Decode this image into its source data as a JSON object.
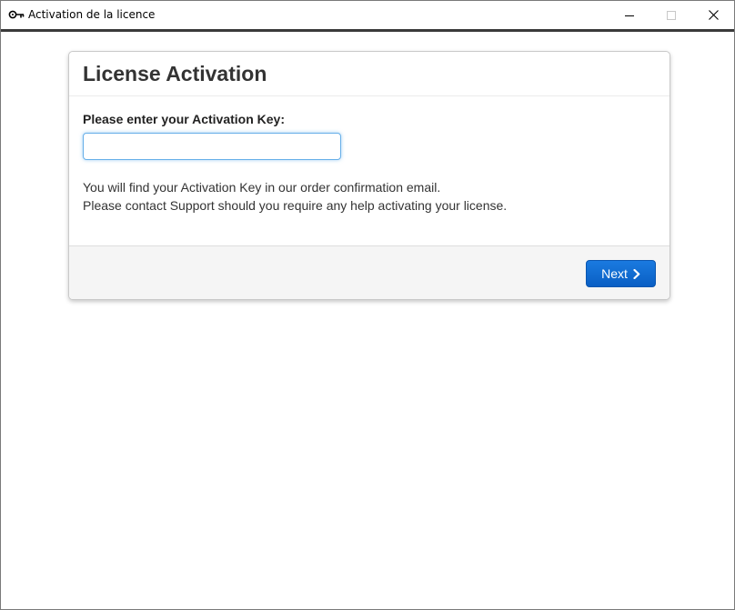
{
  "window": {
    "title": "Activation de la licence",
    "icon": "key-icon",
    "controls": [
      "minimize-icon",
      "maximize-icon",
      "close-icon"
    ]
  },
  "panel": {
    "title": "License Activation",
    "field_label": "Please enter your Activation Key:",
    "activation_key": {
      "value": "",
      "placeholder": ""
    },
    "info_line_1": "You will find your Activation Key in our order confirmation email.",
    "info_line_2": "Please contact Support should you require any help activating your license.",
    "next_button": {
      "label": "Next",
      "icon": "chevron-right-icon"
    }
  },
  "colors": {
    "primary_button": "#0a66cf",
    "input_focus_border": "#66afe9",
    "footer_background": "#f5f5f5"
  }
}
